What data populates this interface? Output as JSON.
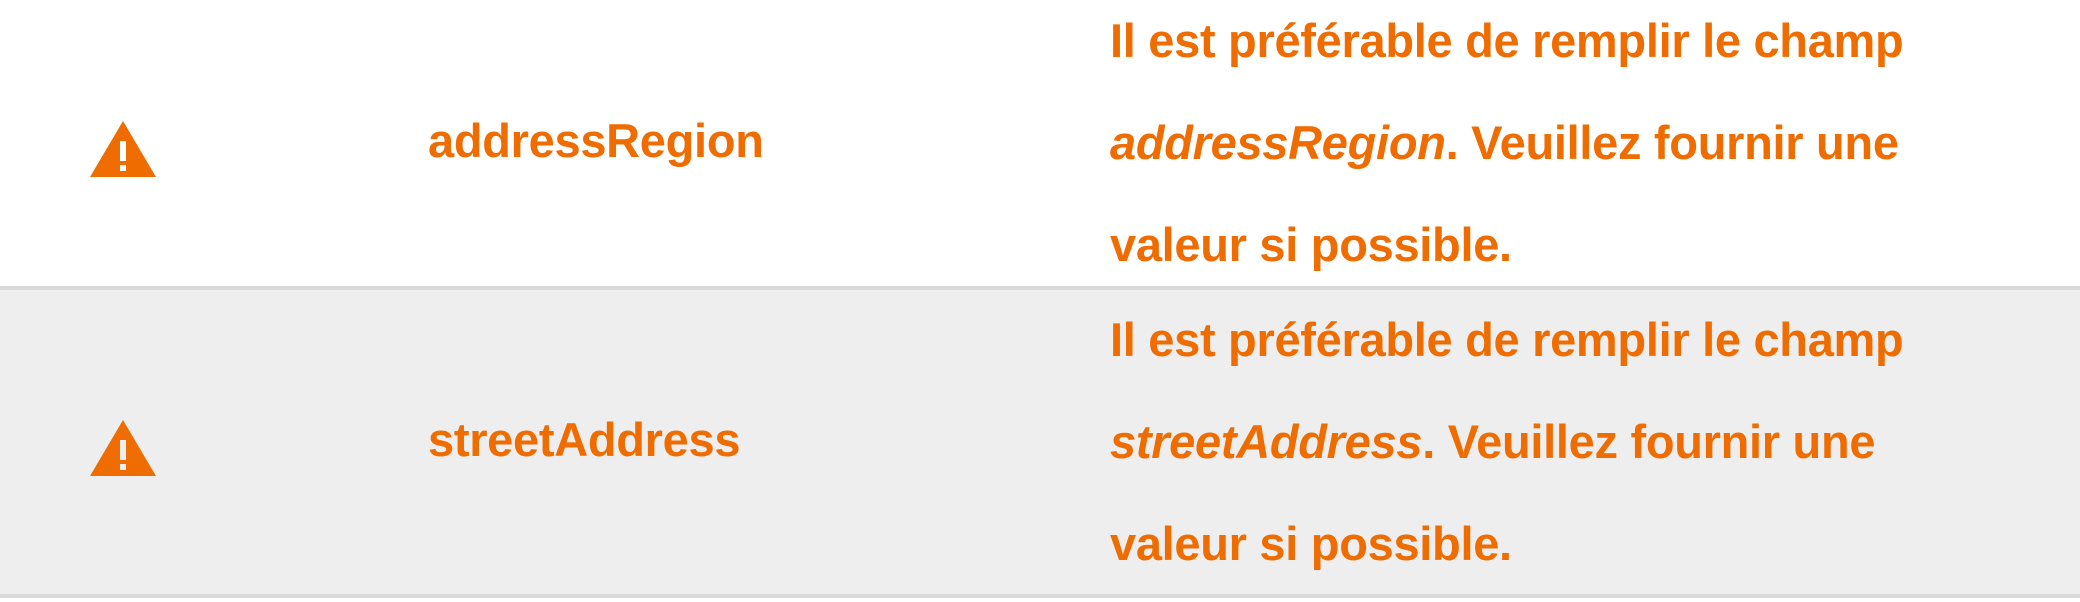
{
  "accent_color": "#ef6c00",
  "rows": [
    {
      "icon": "warning-icon",
      "field": "addressRegion",
      "message": {
        "line1": "Il est préférable de remplir le champ",
        "field": "addressRegion",
        "after_field": ". Veuillez fournir une",
        "line3": "valeur si possible."
      }
    },
    {
      "icon": "warning-icon",
      "field": "streetAddress",
      "message": {
        "line1": "Il est préférable de remplir le champ",
        "field": "streetAddress",
        "after_field": ". Veuillez fournir une",
        "line3": "valeur si possible."
      }
    }
  ]
}
